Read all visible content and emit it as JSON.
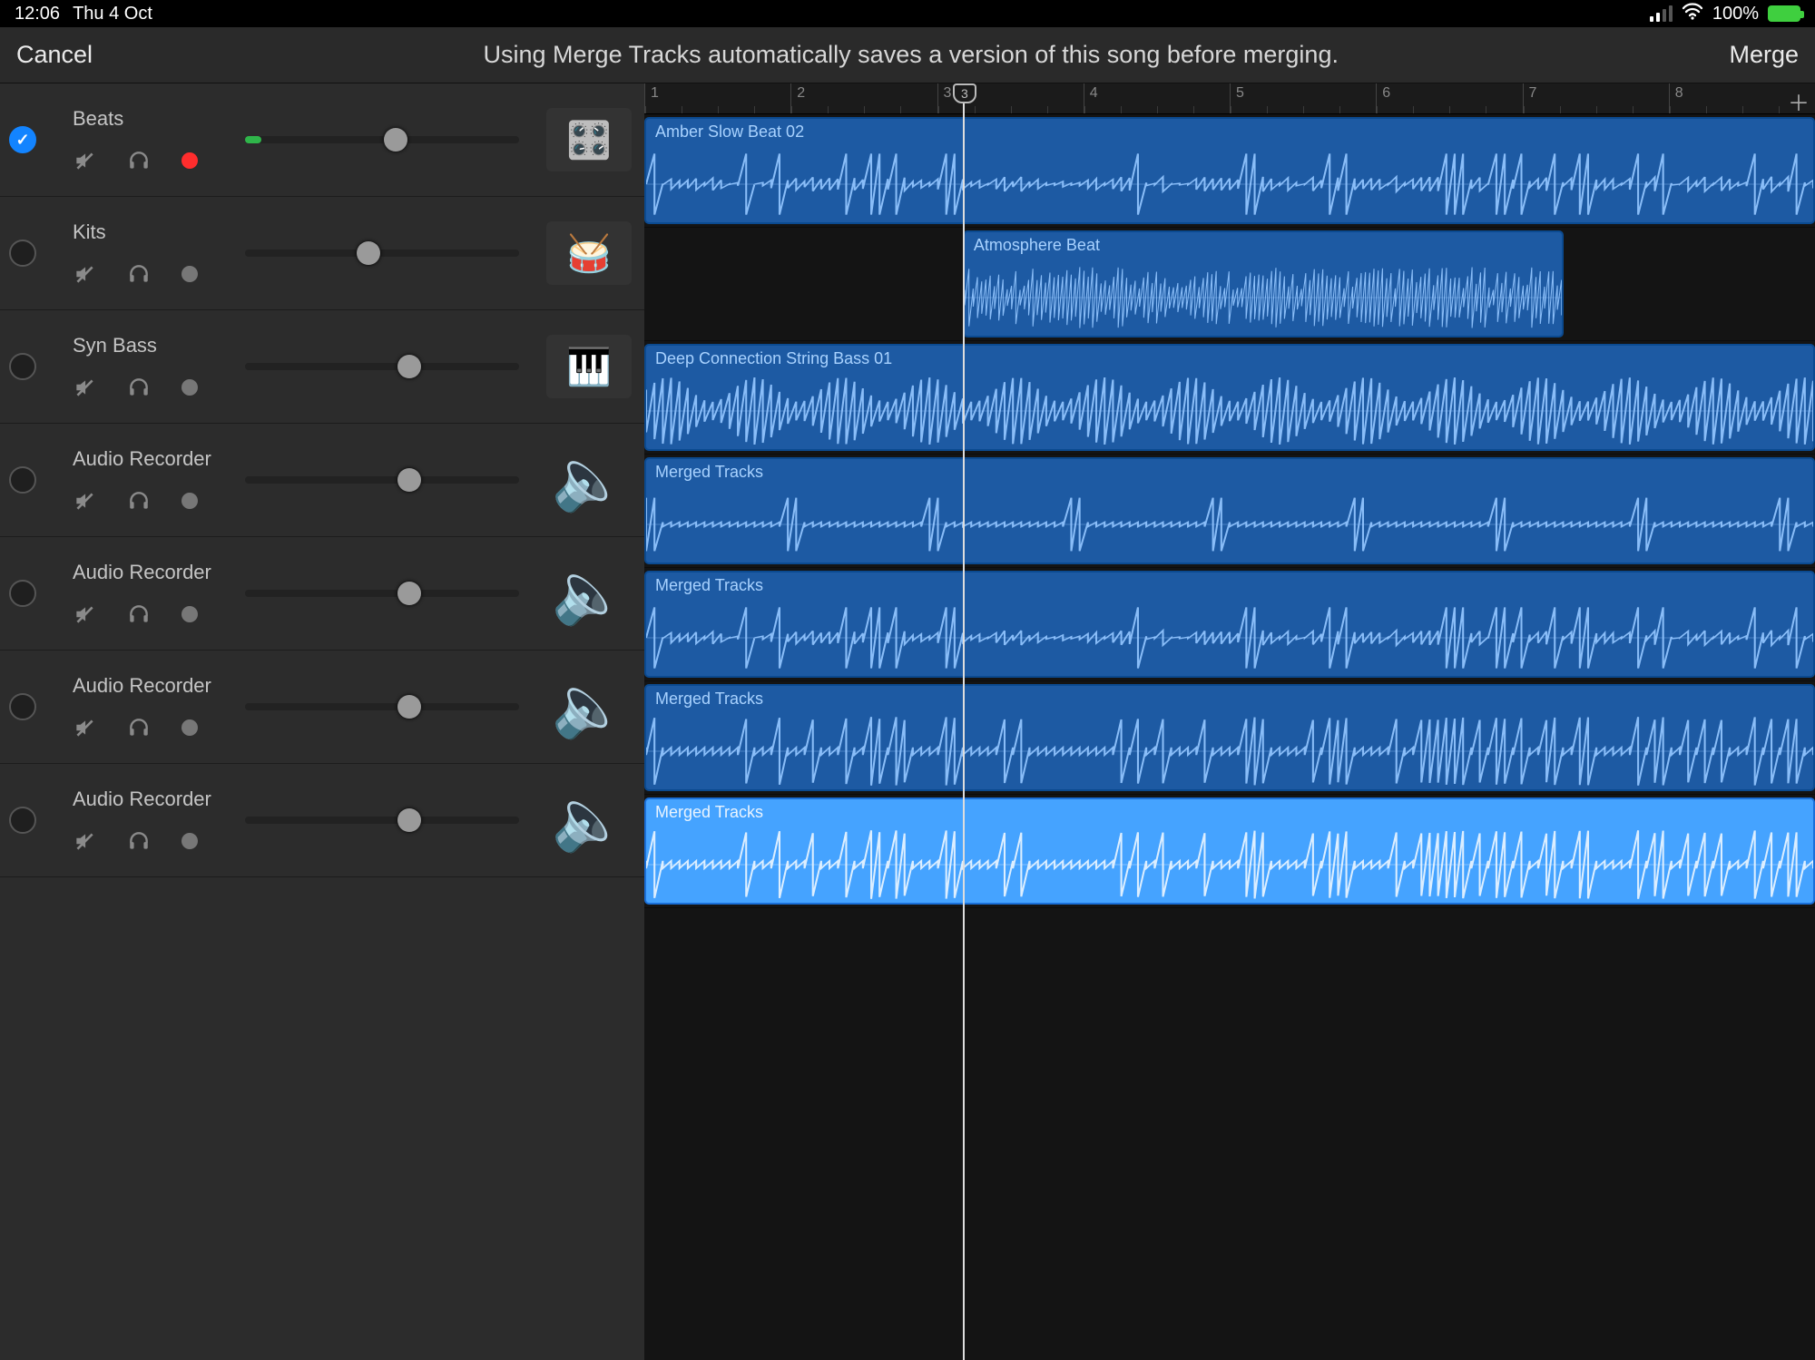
{
  "status": {
    "time": "12:06",
    "date": "Thu 4 Oct",
    "battery_pct": "100%"
  },
  "header": {
    "cancel_label": "Cancel",
    "title": "Using Merge Tracks automatically saves a version of this song before merging.",
    "merge_label": "Merge"
  },
  "ruler": {
    "bars": [
      "1",
      "2",
      "3",
      "4",
      "5",
      "6",
      "7",
      "8"
    ],
    "playhead_bar": "3"
  },
  "tracks": [
    {
      "name": "Beats",
      "selected": true,
      "armed": true,
      "volume": 0.55,
      "meter": 0.06,
      "icon": "sampler",
      "region": {
        "label": "Amber Slow Beat 02",
        "start_pct": 0,
        "end_pct": 100,
        "style": "dark",
        "wave_kind": "spiky"
      }
    },
    {
      "name": "Kits",
      "selected": false,
      "armed": false,
      "volume": 0.45,
      "meter": 0,
      "icon": "drumkit",
      "region": {
        "label": "Atmosphere Beat",
        "start_pct": 27.2,
        "end_pct": 78.5,
        "style": "dark",
        "wave_kind": "dense"
      }
    },
    {
      "name": "Syn Bass",
      "selected": false,
      "armed": false,
      "volume": 0.6,
      "meter": 0,
      "icon": "synth",
      "region": {
        "label": "Deep Connection String Bass 01",
        "start_pct": 0,
        "end_pct": 100,
        "style": "dark",
        "wave_kind": "blobs"
      }
    },
    {
      "name": "Audio Recorder",
      "selected": false,
      "armed": false,
      "volume": 0.6,
      "meter": 0,
      "icon": "speaker",
      "region": {
        "label": "Merged Tracks",
        "start_pct": 0,
        "end_pct": 100,
        "style": "dark",
        "wave_kind": "sparse"
      }
    },
    {
      "name": "Audio Recorder",
      "selected": false,
      "armed": false,
      "volume": 0.6,
      "meter": 0,
      "icon": "speaker",
      "region": {
        "label": "Merged Tracks",
        "start_pct": 0,
        "end_pct": 100,
        "style": "dark",
        "wave_kind": "spiky"
      }
    },
    {
      "name": "Audio Recorder",
      "selected": false,
      "armed": false,
      "volume": 0.6,
      "meter": 0,
      "icon": "speaker",
      "region": {
        "label": "Merged Tracks",
        "start_pct": 0,
        "end_pct": 100,
        "style": "dark",
        "wave_kind": "mid"
      }
    },
    {
      "name": "Audio Recorder",
      "selected": false,
      "armed": false,
      "volume": 0.6,
      "meter": 0,
      "icon": "speaker",
      "region": {
        "label": "Merged Tracks",
        "start_pct": 0,
        "end_pct": 100,
        "style": "light",
        "wave_kind": "mid"
      }
    }
  ],
  "playhead_pct": 27.2
}
